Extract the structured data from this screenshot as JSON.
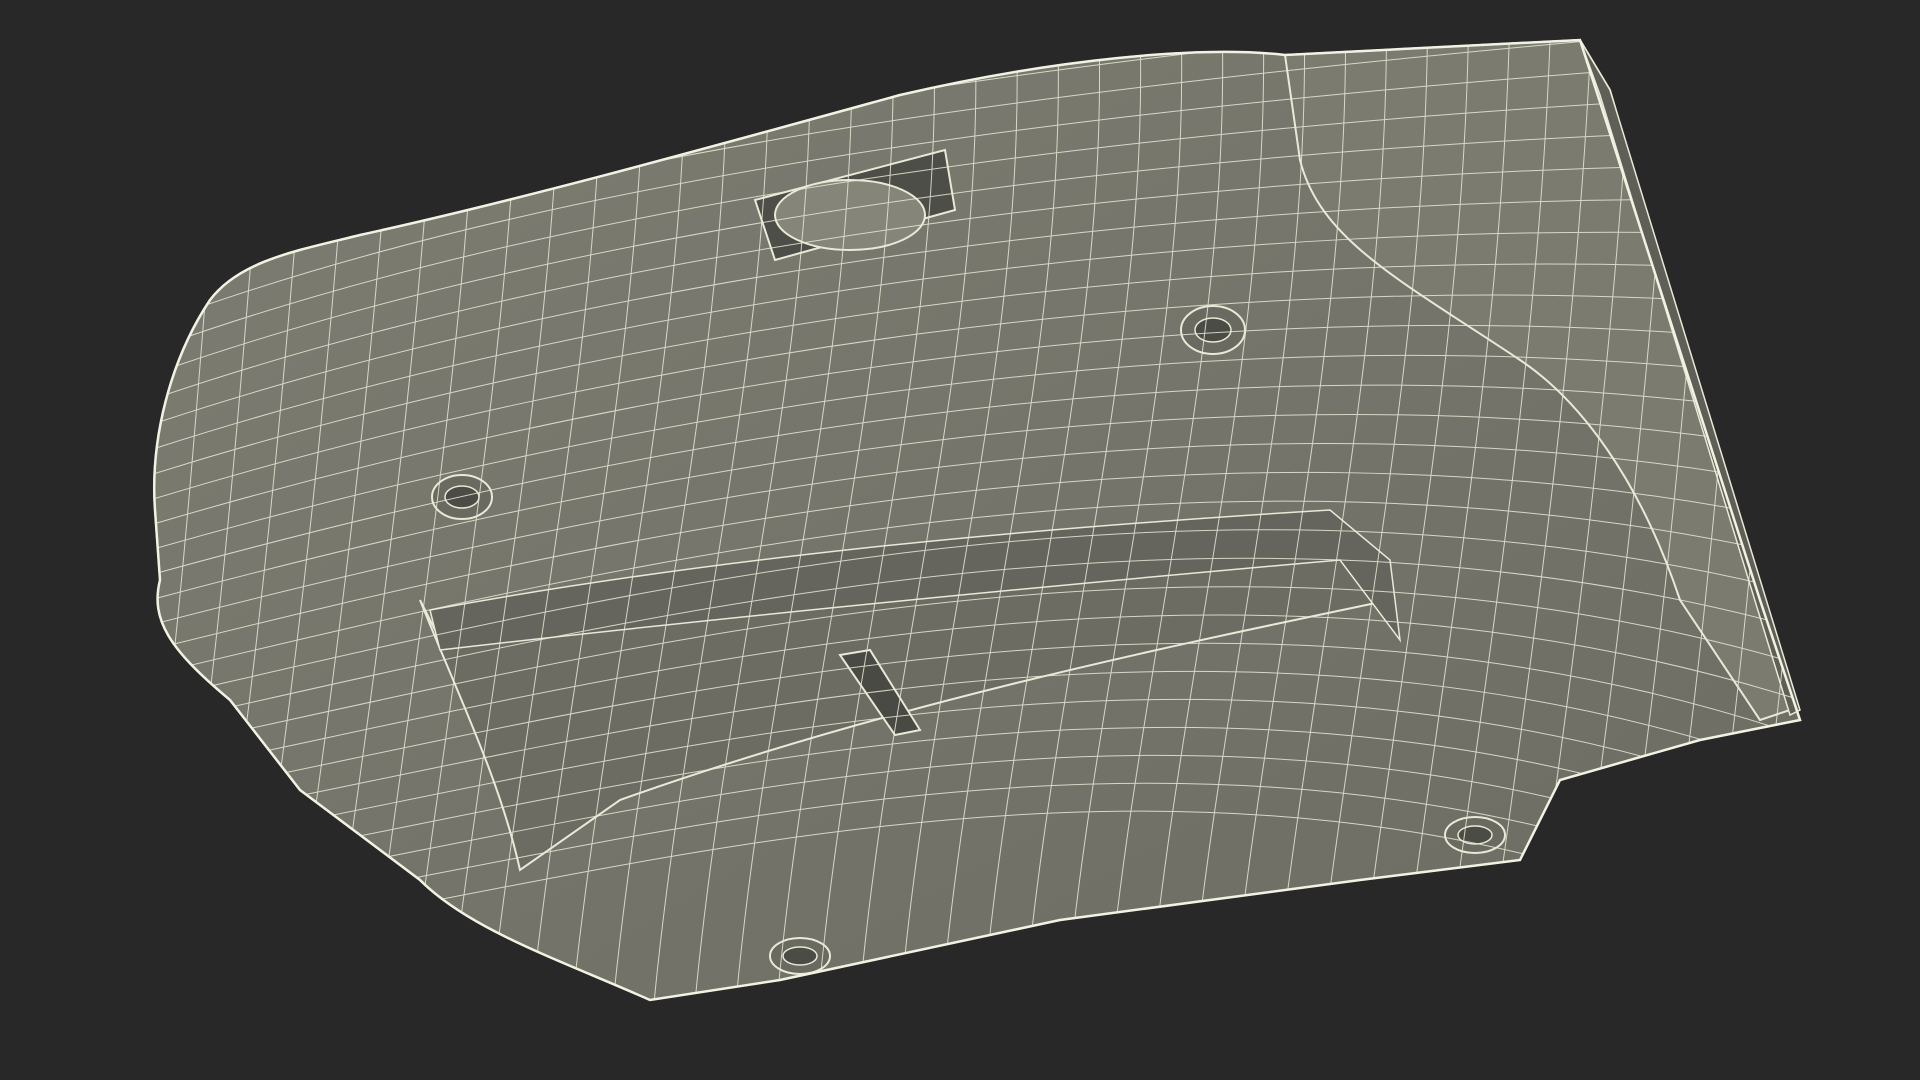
{
  "scene": {
    "background_color": "#282828",
    "object_fill": "#76766c",
    "object_fill_light": "#7d7d72",
    "object_fill_dark": "#5f5f57",
    "wire_color": "#e9e9d8",
    "render_style": "wireframe-on-shaded",
    "subject": "3d-model-wireframe"
  }
}
